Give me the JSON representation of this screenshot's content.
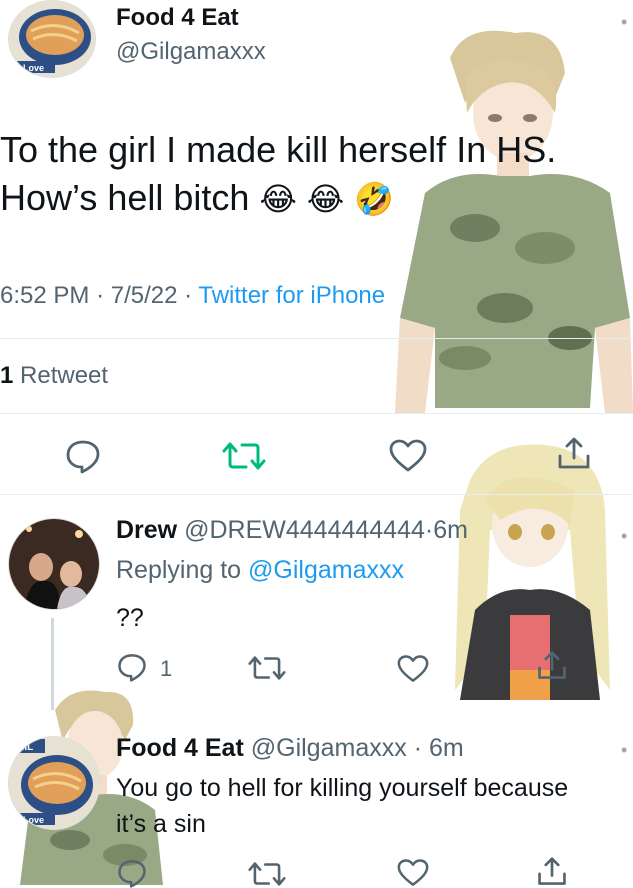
{
  "main_tweet": {
    "author_name": "Food 4 Eat",
    "author_handle": "@Gilgamaxxx",
    "avatar_caption": "I Love",
    "text_line1": "To the girl I made kill herself In HS.",
    "text_line2": "How’s hell bitch",
    "emojis": [
      "😂",
      "😂",
      "🤣"
    ],
    "time": "6:52 PM",
    "sep1": "·",
    "date": "7/5/22",
    "sep2": "·",
    "source": "Twitter for iPhone",
    "retweet_count": "1",
    "retweet_label": "Retweet"
  },
  "reply1": {
    "author_name": "Drew",
    "author_handle": "@DREW4444444444",
    "time_fragment": "·6m",
    "replying_prefix": "Replying to",
    "replying_handle": "@Gilgamaxxx",
    "text": "??",
    "reply_count": "1"
  },
  "reply2": {
    "author_name": "Food 4 Eat",
    "author_handle": "@Gilgamaxxx",
    "sep": "·",
    "time": "6m",
    "avatar_caption": "I Love",
    "avatar_badge": "MIL",
    "text_line1": "You go to hell for killing yourself because",
    "text_line2": "it’s a sin"
  },
  "icons": {
    "reply": "reply-icon",
    "retweet": "retweet-icon",
    "like": "heart-icon",
    "share": "share-icon",
    "more": "more-icon"
  },
  "colors": {
    "retweet_active": "#00ba7c",
    "link": "#1d9bf0",
    "muted": "#536471",
    "icon": "#536471"
  }
}
